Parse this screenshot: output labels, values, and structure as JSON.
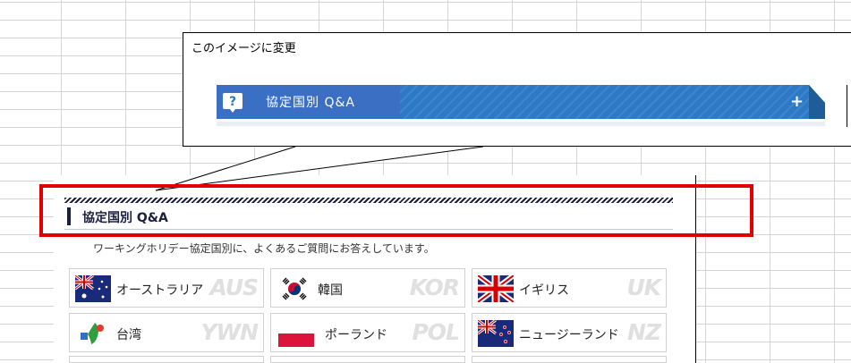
{
  "callout": {
    "title": "このイメージに変更",
    "bar_label": "協定国別 Q&A",
    "plus": "+",
    "icon_glyph": "?"
  },
  "section": {
    "heading": "協定国別 Q&A",
    "intro": "ワーキングホリデー協定国別に、よくあるご質問にお答えしています。"
  },
  "countries": [
    {
      "name": "オーストラリア",
      "code": "AUS",
      "flag": "australia-flag"
    },
    {
      "name": "韓国",
      "code": "KOR",
      "flag": "korea-flag"
    },
    {
      "name": "イギリス",
      "code": "UK",
      "flag": "uk-flag"
    },
    {
      "name": "台湾",
      "code": "YWN",
      "flag": "taiwan-logo"
    },
    {
      "name": "ポーランド",
      "code": "POL",
      "flag": "poland-flag"
    },
    {
      "name": "ニュージーランド",
      "code": "NZ",
      "flag": "new-zealand-flag"
    }
  ],
  "colors": {
    "bar_blue": "#2f78c3",
    "highlight_red": "#e00000",
    "heading_navy": "#1a1f3d"
  }
}
